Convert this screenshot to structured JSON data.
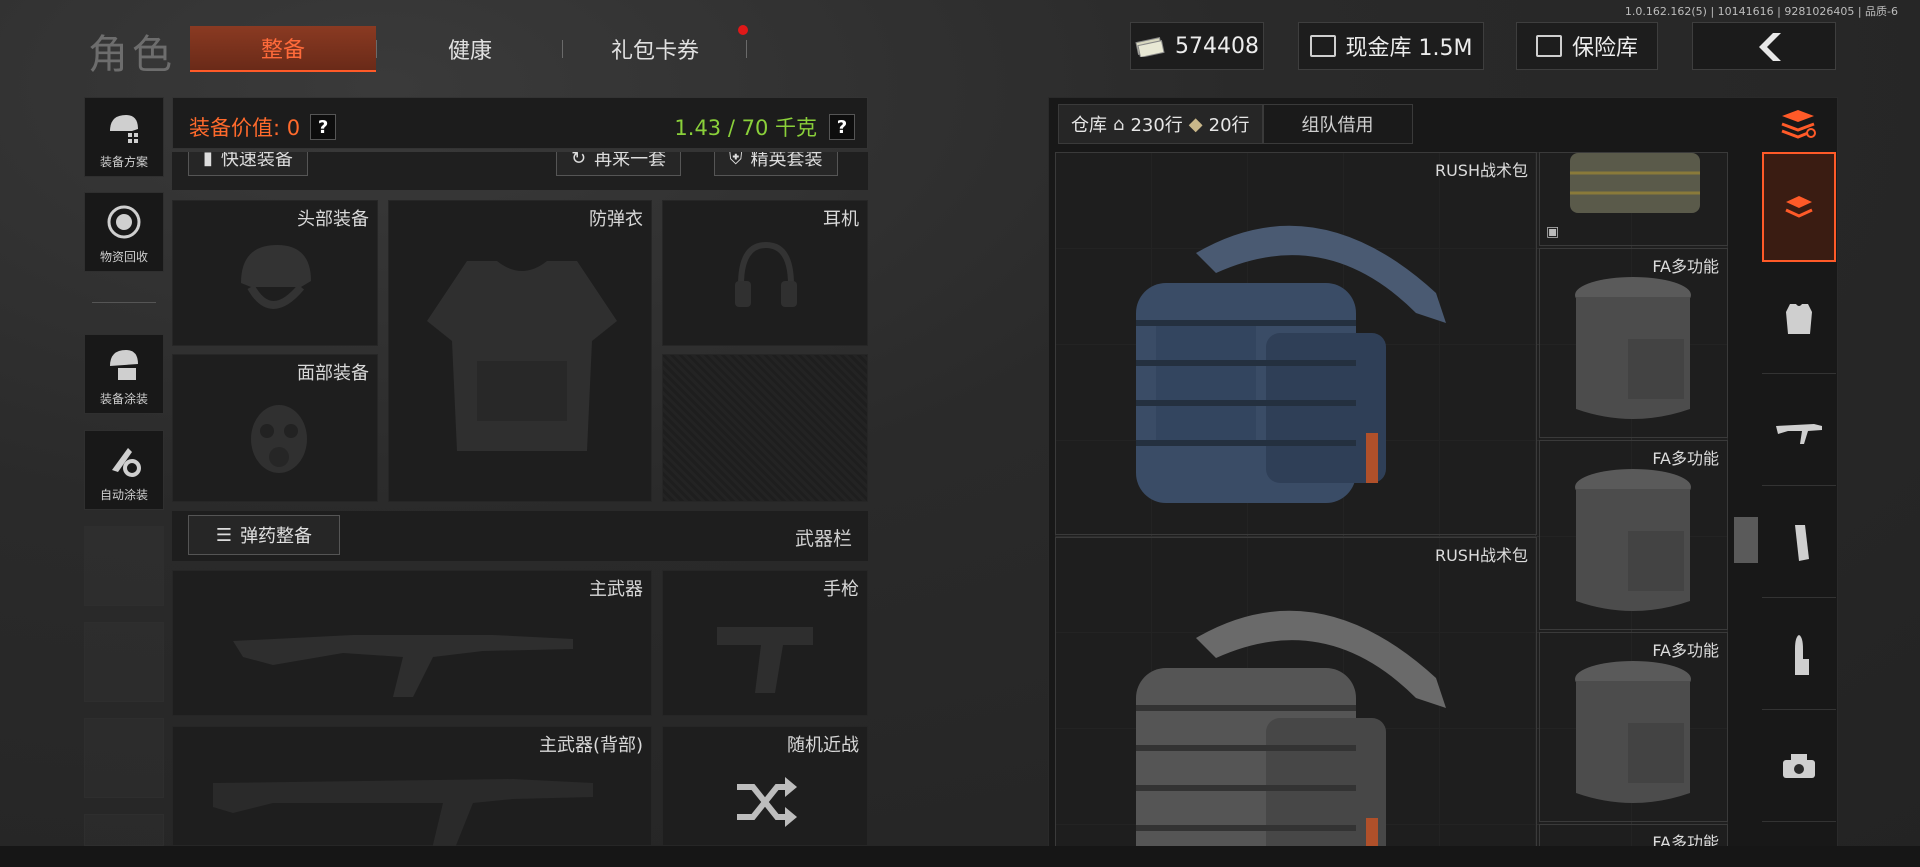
{
  "build_info": "1.0.162.162(5) | 10141616 | 9281026405 | 品质-6",
  "page_title": "角色",
  "tabs": [
    {
      "label": "整备",
      "active": true
    },
    {
      "label": "健康",
      "active": false
    },
    {
      "label": "礼包卡券",
      "active": false,
      "notification": true
    }
  ],
  "header": {
    "currency": "574408",
    "cash_vault": "现金库 1.5M",
    "safe_box": "保险库"
  },
  "sidebar": {
    "items": [
      {
        "label": "装备方案",
        "icon": "helmet-grid-icon"
      },
      {
        "label": "物资回收",
        "icon": "recycle-icon"
      },
      {
        "label": "装备涂装",
        "icon": "helmet-paint-icon"
      },
      {
        "label": "自动涂装",
        "icon": "brush-gear-icon"
      }
    ]
  },
  "loadout": {
    "value_label": "装备价值: 0",
    "weight_label": "1.43 / 70 千克",
    "help": "?",
    "quick_equip": "快速装备",
    "again": "再来一套",
    "elite_kit": "精英套装",
    "slots": {
      "head": "头部装备",
      "armor": "防弹衣",
      "headset": "耳机",
      "face": "面部装备",
      "primary": "主武器",
      "pistol": "手枪",
      "primary_back": "主武器(背部)",
      "melee": "随机近战"
    },
    "ammo_button": "弹药整备",
    "weapon_bar": "武器栏"
  },
  "warehouse": {
    "tab_label": "仓库",
    "rows_home": "230行",
    "rows_ext": "20行",
    "team_borrow": "组队借用",
    "items": {
      "rush_1": "RUSH战术包",
      "rush_2": "RUSH战术包",
      "fa_1": "FA多功能",
      "fa_2": "FA多功能",
      "fa_3": "FA多功能",
      "fa_4": "FA多功能"
    }
  },
  "categories": [
    "stack-sort-icon",
    "backpack-icon",
    "vest-icon",
    "rifle-icon",
    "magazine-icon",
    "ammo-icon",
    "scope-icon"
  ],
  "colors": {
    "accent": "#ff5a28",
    "value_text": "#ff6a2c",
    "weight_text": "#8ad03a",
    "notification": "#e01818"
  }
}
